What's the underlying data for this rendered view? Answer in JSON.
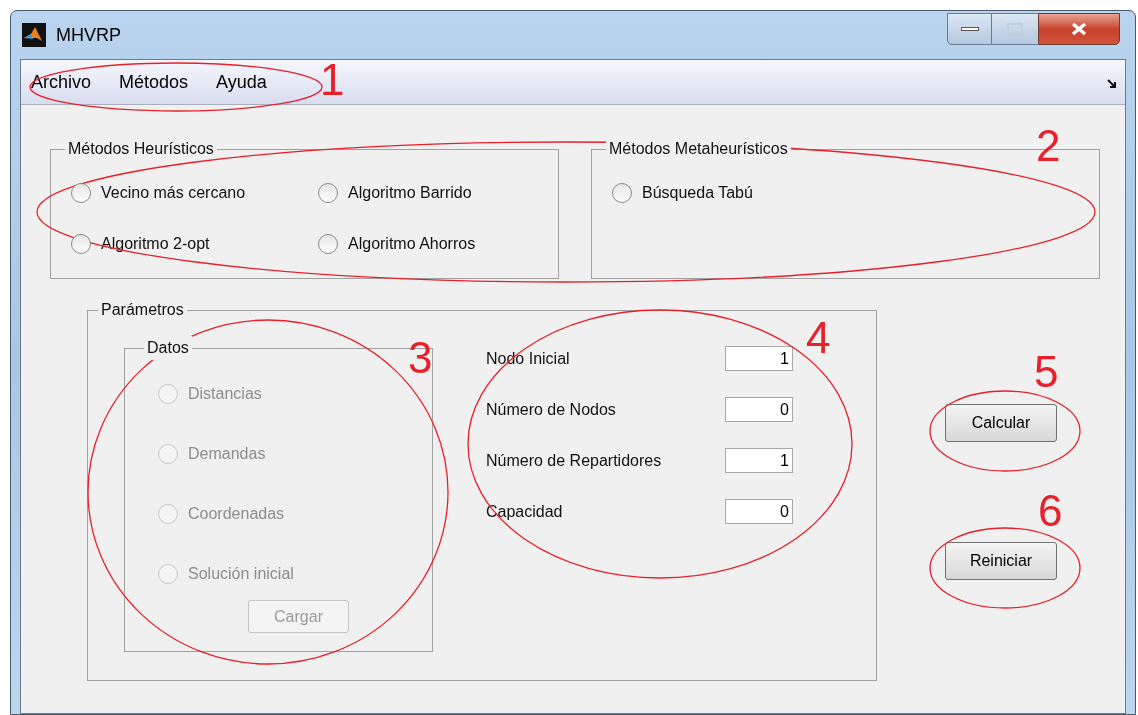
{
  "window": {
    "title": "MHVRP"
  },
  "menu": [
    "Archivo",
    "Métodos",
    "Ayuda"
  ],
  "heuristic_panel": {
    "title": "Métodos Heurísticos",
    "options": [
      {
        "label": "Vecino más cercano",
        "selected": false
      },
      {
        "label": "Algoritmo Barrido",
        "selected": false
      },
      {
        "label": "Algoritmo 2-opt",
        "selected": false
      },
      {
        "label": "Algoritmo Ahorros",
        "selected": false
      }
    ]
  },
  "metaheuristic_panel": {
    "title": "Métodos Metaheurísticos",
    "options": [
      {
        "label": "Búsqueda Tabú",
        "selected": false
      }
    ]
  },
  "parameters_panel": {
    "title": "Parámetros",
    "data_panel": {
      "title": "Datos",
      "disabled": true,
      "options": [
        {
          "label": "Distancias",
          "selected": false
        },
        {
          "label": "Demandas",
          "selected": false
        },
        {
          "label": "Coordenadas",
          "selected": false
        },
        {
          "label": "Solución inicial",
          "selected": false
        }
      ],
      "button": "Cargar"
    },
    "fields": [
      {
        "label": "Nodo Inicial",
        "value": "1"
      },
      {
        "label": "Número de Nodos",
        "value": "0"
      },
      {
        "label": "Número de Repartidores",
        "value": "1"
      },
      {
        "label": "Capacidad",
        "value": "0"
      }
    ]
  },
  "buttons": [
    "Calcular",
    "Reiniciar"
  ],
  "annotations": [
    "1",
    "2",
    "3",
    "4",
    "5",
    "6"
  ]
}
